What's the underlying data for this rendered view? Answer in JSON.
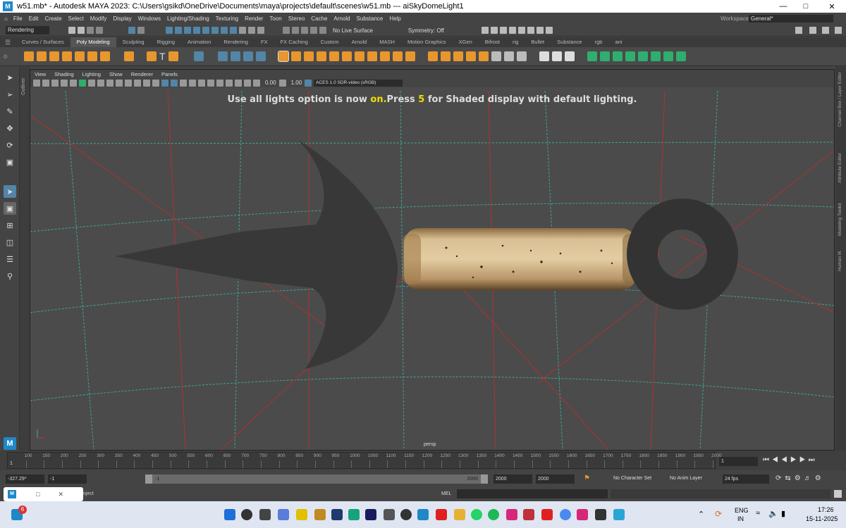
{
  "window": {
    "title": "w51.mb* - Autodesk MAYA 2023: C:\\Users\\gsikd\\OneDrive\\Documents\\maya\\projects\\default\\scenes\\w51.mb   ---   aiSkyDomeLight1",
    "app_icon": "M"
  },
  "menubar": {
    "items": [
      "File",
      "Edit",
      "Create",
      "Select",
      "Modify",
      "Display",
      "Windows",
      "Lighting/Shading",
      "Texturing",
      "Render",
      "Toon",
      "Stereo",
      "Cache",
      "Arnold",
      "Substance",
      "Help"
    ],
    "workspace_label": "Workspace:",
    "workspace_value": "General*"
  },
  "statusline": {
    "menuset": "Rendering",
    "live_surface": "No Live Surface",
    "symmetry": "Symmetry: Off"
  },
  "shelf": {
    "tabs": [
      "Curves / Surfaces",
      "Poly Modeling",
      "Sculpting",
      "Rigging",
      "Animation",
      "Rendering",
      "FX",
      "FX Caching",
      "Custom",
      "Arnold",
      "MASH",
      "Motion Graphics",
      "XGen",
      "Bifrost",
      "rig",
      "Bullet",
      "Substance",
      "rgb",
      "ani"
    ],
    "active_tab": "Poly Modeling"
  },
  "panel": {
    "menus": [
      "View",
      "Shading",
      "Lighting",
      "Show",
      "Renderer",
      "Panels"
    ],
    "exposure": "0.00",
    "gamma": "1.00",
    "color_space": "ACES 1.0 SDR-video (sRGB)",
    "camera_label": "persp",
    "hud_part1": "Use all lights option is now ",
    "hud_on": "on.",
    "hud_part2": "Press ",
    "hud_key": "5",
    "hud_part3": " for Shaded display with default lighting."
  },
  "left_labels": {
    "outliner": "Outliner"
  },
  "right_dock": [
    "Channel Box / Layer Editor",
    "Attribute Editor",
    "Modeling Toolkit",
    "Human IK"
  ],
  "timeline": {
    "ticks": [
      "1",
      "100",
      "150",
      "200",
      "250",
      "300",
      "350",
      "400",
      "450",
      "500",
      "550",
      "600",
      "650",
      "700",
      "750",
      "800",
      "850",
      "900",
      "950",
      "1000",
      "1050",
      "1100",
      "1150",
      "1200",
      "1250",
      "1300",
      "1350",
      "1400",
      "1450",
      "1500",
      "1550",
      "1600",
      "1650",
      "1700",
      "1750",
      "1800",
      "1850",
      "1900",
      "1950",
      "2000"
    ],
    "current_frame": "1"
  },
  "range": {
    "start": "-327.29*",
    "playback_start": "-1",
    "range_label": "-1",
    "range_end_label": "2000",
    "end1": "2000",
    "end2": "2000",
    "character_set": "No Character Set",
    "anim_layer": "No Anim Layer",
    "fps": "24 fps"
  },
  "cmdline": {
    "lang": "MEL",
    "left_text": "oject"
  },
  "taskbar": {
    "badge": "6",
    "lang1": "ENG",
    "lang2": "IN",
    "time": "17:26",
    "date": "15-11-2025"
  },
  "colors": {
    "accent": "#5285a6",
    "hud_yellow": "#f0e000",
    "grid_red": "#c03030",
    "grid_green": "#3fae9e"
  }
}
